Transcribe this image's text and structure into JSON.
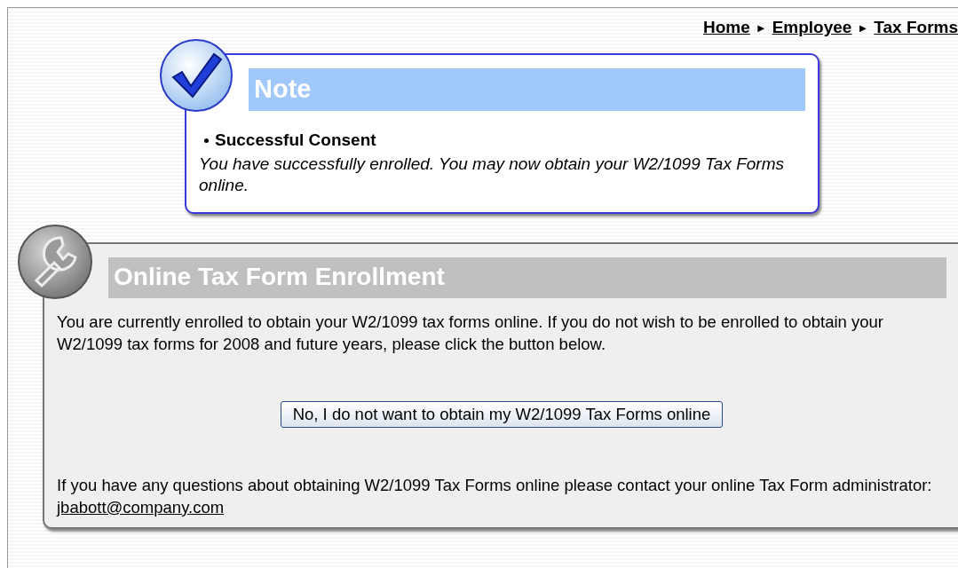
{
  "breadcrumb": {
    "links": [
      "Home",
      "Employee",
      "Tax Forms"
    ],
    "separators": [
      "►",
      "►"
    ]
  },
  "note": {
    "title": "Note",
    "items": [
      {
        "heading": "Successful Consent",
        "text": "You have successfully enrolled. You may now obtain your W2/1099 Tax Forms online."
      }
    ]
  },
  "enrollment": {
    "title": "Online Tax Form Enrollment",
    "intro": "You are currently enrolled to obtain your W2/1099 tax forms online. If you do not wish to be enrolled to obtain your W2/1099 tax forms for 2008 and future years, please click the button below.",
    "button": "No, I do not want to obtain my W2/1099 Tax Forms online",
    "contact_text": "If you have any questions about obtaining W2/1099 Tax Forms online please contact your online Tax Form administrator:",
    "contact_link": "jbabott@company.com"
  }
}
